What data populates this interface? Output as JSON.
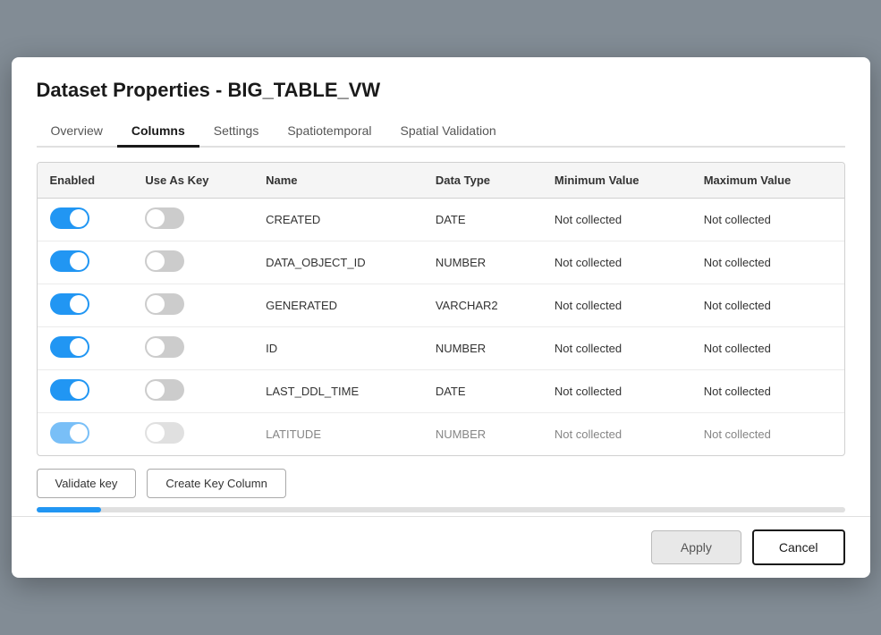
{
  "modal": {
    "title": "Dataset Properties - BIG_TABLE_VW"
  },
  "tabs": [
    {
      "id": "overview",
      "label": "Overview",
      "active": false
    },
    {
      "id": "columns",
      "label": "Columns",
      "active": true
    },
    {
      "id": "settings",
      "label": "Settings",
      "active": false
    },
    {
      "id": "spatiotemporal",
      "label": "Spatiotemporal",
      "active": false
    },
    {
      "id": "spatial-validation",
      "label": "Spatial Validation",
      "active": false
    }
  ],
  "table": {
    "headers": [
      "Enabled",
      "Use As Key",
      "Name",
      "Data Type",
      "Minimum Value",
      "Maximum Value"
    ],
    "rows": [
      {
        "enabled": true,
        "useAsKey": false,
        "name": "CREATED",
        "dataType": "DATE",
        "minValue": "Not collected",
        "maxValue": "Not collected"
      },
      {
        "enabled": true,
        "useAsKey": false,
        "name": "DATA_OBJECT_ID",
        "dataType": "NUMBER",
        "minValue": "Not collected",
        "maxValue": "Not collected"
      },
      {
        "enabled": true,
        "useAsKey": false,
        "name": "GENERATED",
        "dataType": "VARCHAR2",
        "minValue": "Not collected",
        "maxValue": "Not collected"
      },
      {
        "enabled": true,
        "useAsKey": false,
        "name": "ID",
        "dataType": "NUMBER",
        "minValue": "Not collected",
        "maxValue": "Not collected"
      },
      {
        "enabled": true,
        "useAsKey": false,
        "name": "LAST_DDL_TIME",
        "dataType": "DATE",
        "minValue": "Not collected",
        "maxValue": "Not collected"
      },
      {
        "enabled": true,
        "useAsKey": false,
        "name": "LATITUDE",
        "dataType": "NUMBER",
        "minValue": "Not collected",
        "maxValue": "Not collected"
      }
    ]
  },
  "buttons": {
    "validate_key": "Validate key",
    "create_key_column": "Create Key Column",
    "apply": "Apply",
    "cancel": "Cancel"
  },
  "progress": {
    "value": 8
  }
}
